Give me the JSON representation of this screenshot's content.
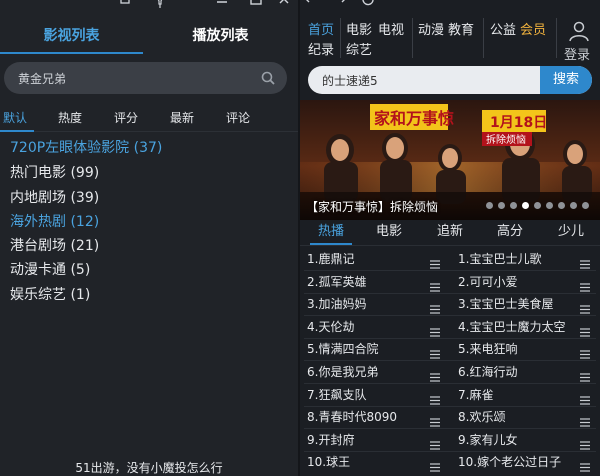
{
  "left_panel": {
    "tabs": [
      {
        "label": "影视列表",
        "active": true
      },
      {
        "label": "播放列表",
        "active": false
      }
    ],
    "search": {
      "value": "黄金兄弟"
    },
    "sort_options": [
      "默认",
      "热度",
      "评分",
      "最新",
      "评论"
    ],
    "sort_active_index": 0,
    "categories": [
      {
        "label": "720P左眼体验影院 (37)",
        "highlight": true
      },
      {
        "label": "热门电影 (99)",
        "highlight": false
      },
      {
        "label": "内地剧场 (39)",
        "highlight": false
      },
      {
        "label": "海外热剧 (12)",
        "highlight": true
      },
      {
        "label": "港台剧场 (21)",
        "highlight": false
      },
      {
        "label": "动漫卡通 (5)",
        "highlight": false
      },
      {
        "label": "娱乐综艺 (1)",
        "highlight": false
      }
    ],
    "bottom_text": "51出游，没有小魔投怎么行"
  },
  "right_panel": {
    "nav": {
      "row1": [
        "首页",
        "电影",
        "电视",
        "动漫",
        "教育",
        "公益",
        "会员"
      ],
      "row2": [
        "纪录",
        "综艺"
      ],
      "active": "首页",
      "gold": "会员",
      "login_label": "登录"
    },
    "search": {
      "value": "的士速递5",
      "button_label": "搜索"
    },
    "banner": {
      "caption": "【家和万事惊】拆除烦恼",
      "poster_title": "家和万事惊",
      "poster_date": "1月18日",
      "poster_note": "拆除烦恼",
      "dot_count": 9,
      "active_dot": 3
    },
    "tabs": [
      "热播",
      "电影",
      "追新",
      "高分",
      "少儿"
    ],
    "tab_active_index": 0,
    "hot_left": [
      "1.鹿鼎记",
      "2.孤军英雄",
      "3.加油妈妈",
      "4.天伦劫",
      "5.情满四合院",
      "6.你是我兄弟",
      "7.狂飙支队",
      "8.青春时代8090",
      "9.开封府",
      "10.球王"
    ],
    "hot_right": [
      "1.宝宝巴士儿歌",
      "2.可可小爱",
      "3.宝宝巴士美食屋",
      "4.宝宝巴士魔力太空",
      "5.来电狂响",
      "6.红海行动",
      "7.麻雀",
      "8.欢乐颂",
      "9.家有儿女",
      "10.嫁个老公过日子"
    ]
  },
  "colors": {
    "accent": "#4aa3df",
    "gold": "#f0b23e",
    "background_left": "#202328",
    "background_right": "#1b1e23"
  },
  "icons": [
    "restore-icon",
    "pin-icon",
    "minimize-icon",
    "maximize-icon",
    "back-arrow-icon",
    "forward-arrow-icon",
    "refresh-icon",
    "search-icon",
    "user-icon",
    "list-icon"
  ]
}
